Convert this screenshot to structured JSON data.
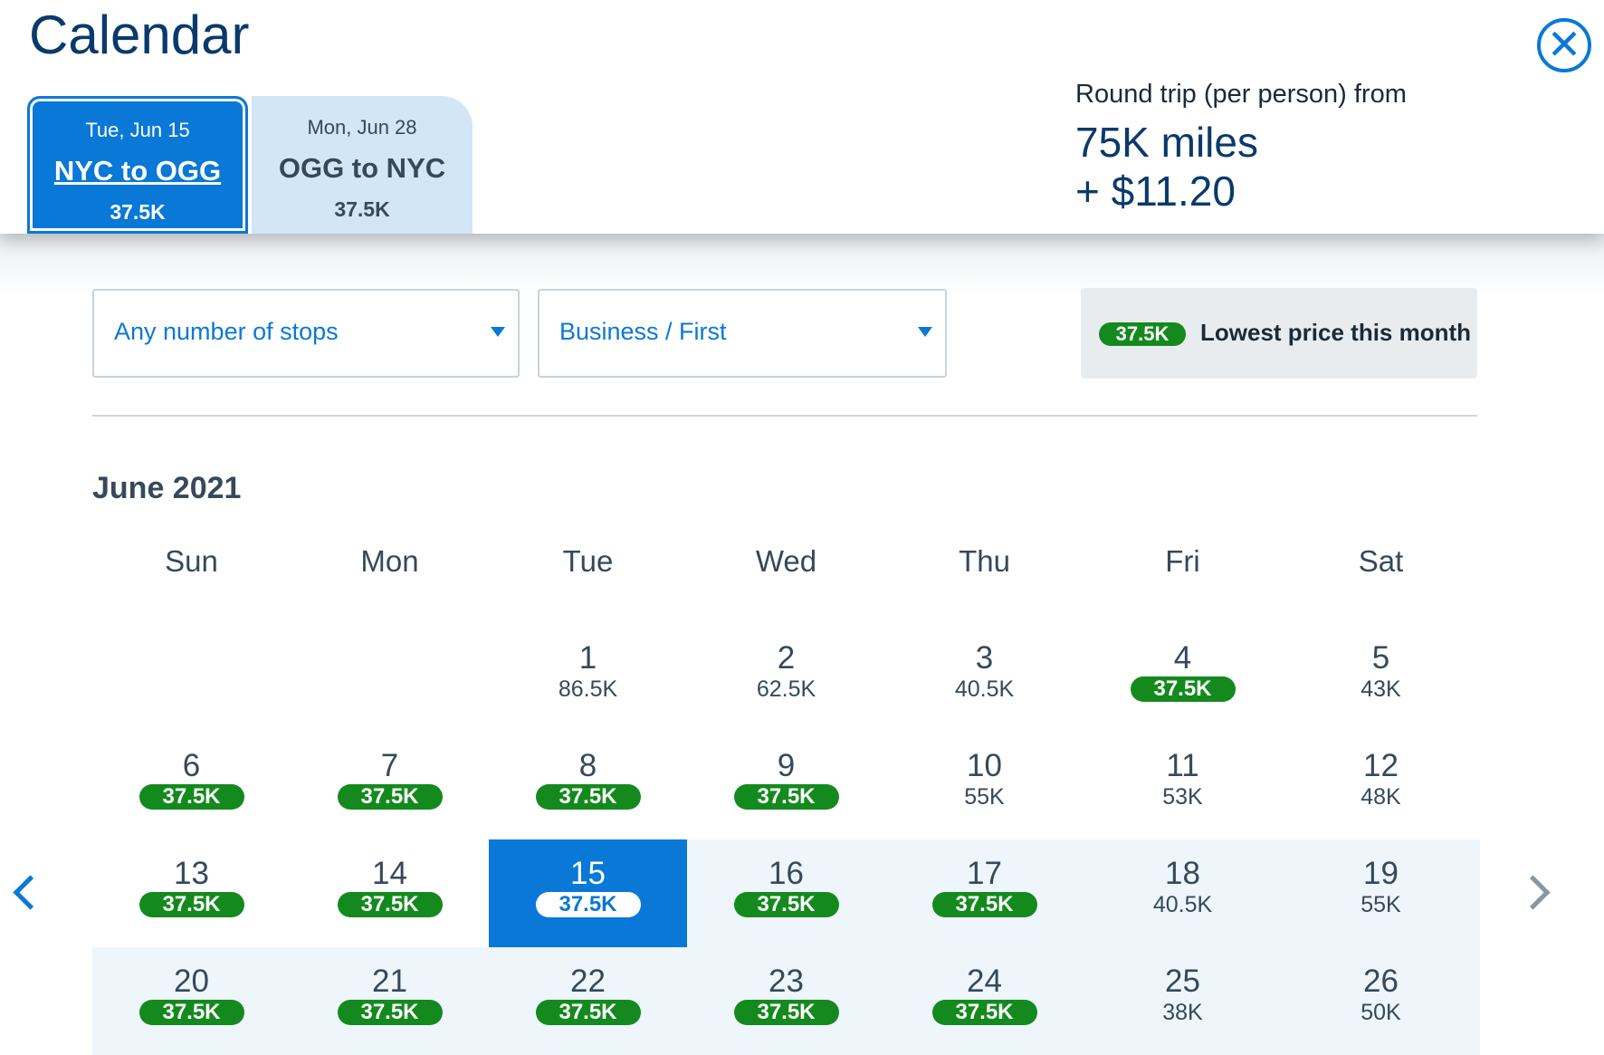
{
  "header": {
    "title": "Calendar",
    "close_icon": "close-icon",
    "tabs": [
      {
        "date": "Tue, Jun 15",
        "route": "NYC to OGG",
        "price": "37.5K"
      },
      {
        "date": "Mon, Jun 28",
        "route": "OGG to NYC",
        "price": "37.5K"
      }
    ],
    "summary": {
      "label": "Round trip (per person) from",
      "miles": "75K miles",
      "cash": "+ $11.20"
    }
  },
  "filters": {
    "stops": "Any number of stops",
    "cabin": "Business / First"
  },
  "legend": {
    "price": "37.5K",
    "text": "Lowest price this month"
  },
  "calendar": {
    "month": "June 2021",
    "weekdays": [
      "Sun",
      "Mon",
      "Tue",
      "Wed",
      "Thu",
      "Fri",
      "Sat"
    ],
    "days": [
      {
        "day": "1",
        "price": "86.5K",
        "lowest": false
      },
      {
        "day": "2",
        "price": "62.5K",
        "lowest": false
      },
      {
        "day": "3",
        "price": "40.5K",
        "lowest": false
      },
      {
        "day": "4",
        "price": "37.5K",
        "lowest": true
      },
      {
        "day": "5",
        "price": "43K",
        "lowest": false
      },
      {
        "day": "6",
        "price": "37.5K",
        "lowest": true
      },
      {
        "day": "7",
        "price": "37.5K",
        "lowest": true
      },
      {
        "day": "8",
        "price": "37.5K",
        "lowest": true
      },
      {
        "day": "9",
        "price": "37.5K",
        "lowest": true
      },
      {
        "day": "10",
        "price": "55K",
        "lowest": false
      },
      {
        "day": "11",
        "price": "53K",
        "lowest": false
      },
      {
        "day": "12",
        "price": "48K",
        "lowest": false
      },
      {
        "day": "13",
        "price": "37.5K",
        "lowest": true
      },
      {
        "day": "14",
        "price": "37.5K",
        "lowest": true
      },
      {
        "day": "15",
        "price": "37.5K",
        "lowest": true,
        "selected": true
      },
      {
        "day": "16",
        "price": "37.5K",
        "lowest": true,
        "in_range": true
      },
      {
        "day": "17",
        "price": "37.5K",
        "lowest": true,
        "in_range": true
      },
      {
        "day": "18",
        "price": "40.5K",
        "lowest": false,
        "in_range": true
      },
      {
        "day": "19",
        "price": "55K",
        "lowest": false,
        "in_range": true
      },
      {
        "day": "20",
        "price": "37.5K",
        "lowest": true,
        "in_range": true
      },
      {
        "day": "21",
        "price": "37.5K",
        "lowest": true,
        "in_range": true
      },
      {
        "day": "22",
        "price": "37.5K",
        "lowest": true,
        "in_range": true
      },
      {
        "day": "23",
        "price": "37.5K",
        "lowest": true,
        "in_range": true
      },
      {
        "day": "24",
        "price": "37.5K",
        "lowest": true,
        "in_range": true
      },
      {
        "day": "25",
        "price": "38K",
        "lowest": false,
        "in_range": true
      },
      {
        "day": "26",
        "price": "50K",
        "lowest": false,
        "in_range": true
      }
    ],
    "first_weekday_index": 2,
    "prev_icon": "chevron-left-icon",
    "next_icon": "chevron-right-icon"
  },
  "colors": {
    "accent": "#0a78d7",
    "lowest_price": "#148a1e",
    "title": "#0a3a6b",
    "range_highlight": "#eef5fb"
  }
}
